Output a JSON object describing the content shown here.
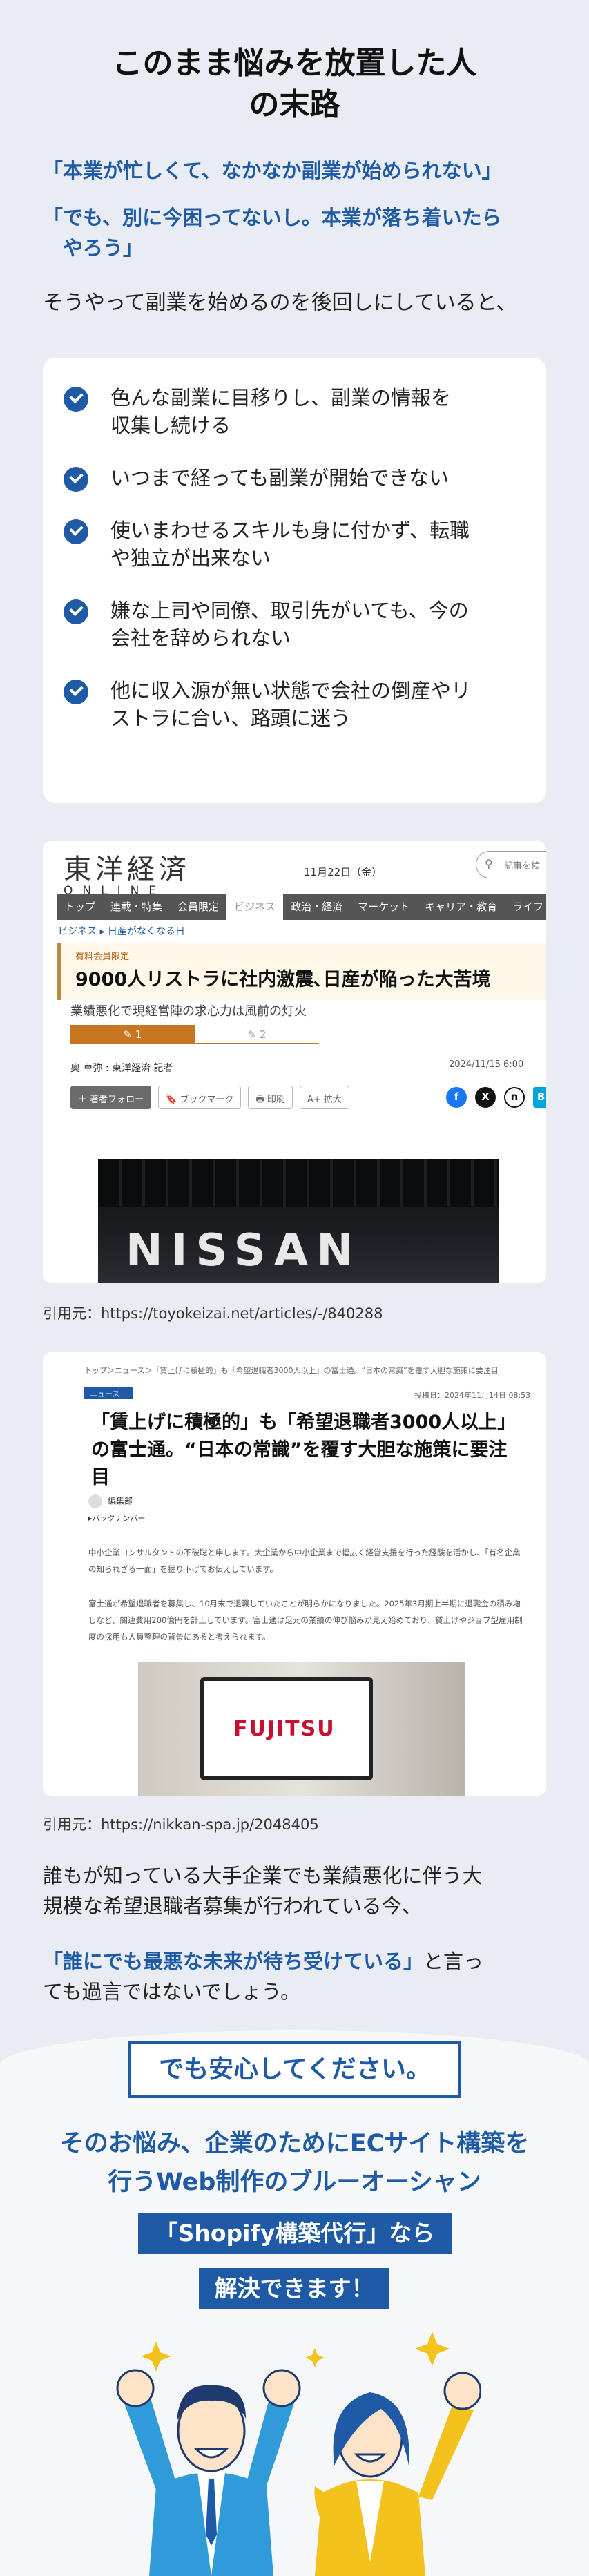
{
  "heading": {
    "title_line1": "このまま悩みを放置した人",
    "title_line2": "の末路"
  },
  "quotes": [
    "「本業が忙しくて、なかなか副業が始められない」",
    "「でも、別に今困ってないし。本業が落ち着いたら",
    "　やろう」"
  ],
  "lead": "そうやって副業を始めるのを後回しにしていると、",
  "checklist": [
    {
      "line1": "色んな副業に目移りし、副業の情報を",
      "line2": "収集し続ける"
    },
    {
      "line1": "いつまで経っても副業が開始できない",
      "line2": ""
    },
    {
      "line1": "使いまわせるスキルも身に付かず、転職",
      "line2": "や独立が出来ない"
    },
    {
      "line1": "嫌な上司や同僚、取引先がいても、今の",
      "line2": "会社を辞められない"
    },
    {
      "line1": "他に収入源が無い状態で会社の倒産やリ",
      "line2": "ストラに合い、路頭に迷う"
    }
  ],
  "article1": {
    "brand": "東洋経済",
    "brand_sub": "ONLINE",
    "date": "11月22日（金）",
    "search_placeholder": "記事を検",
    "nav": [
      "トップ",
      "連載・特集",
      "会員限定",
      "ビジネス",
      "政治・経済",
      "マーケット",
      "キャリア・教育",
      "ライフ"
    ],
    "breadcrumb": "ビジネス ▸ 日産がなくなる日",
    "badge": "有料会員限定",
    "headline": "9000人リストラに社内激震､日産が陥った大苦境",
    "subhead": "業績悪化で現経営陣の求心力は風前の灯火",
    "rating1": "✎ 1",
    "rating2": "✎ 2",
    "author": "奥 卓弥 : 東洋経済 記者",
    "published": "2024/11/15 6:00",
    "actions": [
      "＋ 著者フォロー",
      "🔖 ブックマーク",
      "🖶 印刷",
      "A+ 拡大"
    ],
    "social": [
      "f",
      "X",
      "n",
      "B!"
    ],
    "photo_text": "NISSAN"
  },
  "cite1": "引用元：https://toyokeizai.net/articles/-/840288",
  "article2": {
    "breadcrumb": "トップ＞ニュース＞「賃上げに積極的」も「希望退職者3000人以上」の富士通。“日本の常識”を覆す大胆な施策に要注目",
    "tag": "ニュース",
    "date": "投稿日：2024年11月14日 08:53",
    "headline": "「賃上げに積極的」も「希望退職者3000人以上」の富士通。“日本の常識”を覆す大胆な施策に要注目",
    "editor": "編集部",
    "category": "▸バックナンバー",
    "para1": "中小企業コンサルタントの不破聡と申します。大企業から中小企業まで幅広く経営支援を行った経験を活かし、「有名企業の知られざる一面」を掘り下げてお伝えしています。",
    "para2": "富士通が希望退職者を募集し、10月末で退職していたことが明らかになりました。2025年3月期上半期に退職金の積み増しなど、関連費用200億円を計上しています。富士通は足元の業績の伸び悩みが見え始めており、賃上げやジョブ型雇用制度の採用も人員整理の背景にあると考えられます。",
    "photo_text": "FUJITSU"
  },
  "cite2": "引用元：https://nikkan-spa.jp/2048405",
  "body": {
    "p1_line1": "誰もが知っている大手企業でも業績悪化に伴う大",
    "p1_line2": "規模な希望退職者募集が行われている今、",
    "p2_emph": "「誰にでも最悪な未来が待ち受けている」",
    "p2_rest": "と言っ",
    "p2_line2": "ても過言ではないでしょう。"
  },
  "cta": {
    "relief": "でも安心してください。",
    "line1": "そのお悩み、企業のためにECサイト構築を",
    "line2": "行うWeb制作のブルーオーシャン",
    "pill1": "「Shopify構築代行」なら",
    "pill2": "解決できます！"
  },
  "colors": {
    "accent": "#1f5aa6",
    "background": "#e9edf3"
  }
}
